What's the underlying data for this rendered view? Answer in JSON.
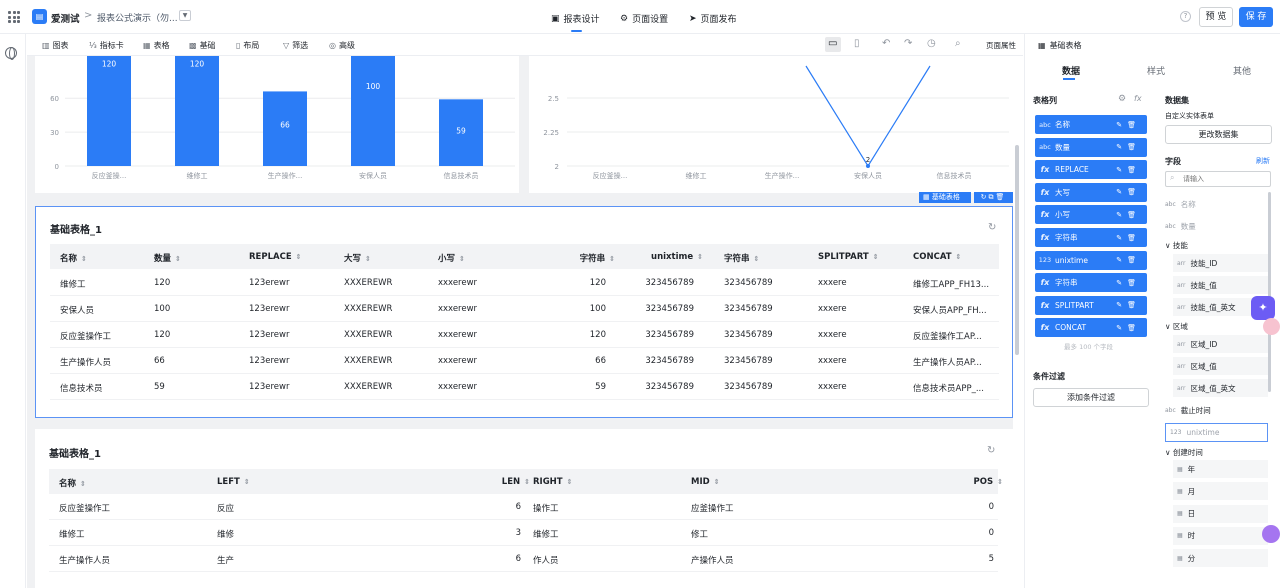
{
  "topbar": {
    "app_name": "爱测试",
    "breadcrumb_sep": ">",
    "report_name": "报表公式演示（勿...",
    "tabs": [
      {
        "label": "报表设计",
        "icon": "report-design-icon"
      },
      {
        "label": "页面设置",
        "icon": "gear-icon"
      },
      {
        "label": "页面发布",
        "icon": "send-icon"
      }
    ],
    "help": "?",
    "preview_label": "预 览",
    "save_label": "保 存"
  },
  "toolbar": {
    "items": [
      {
        "label": "图表",
        "icon": "chart-icon"
      },
      {
        "label": "指标卡",
        "icon": "metric-card-icon"
      },
      {
        "label": "表格",
        "icon": "table-icon"
      },
      {
        "label": "基础",
        "icon": "basic-icon"
      },
      {
        "label": "布局",
        "icon": "layout-icon"
      },
      {
        "label": "筛选",
        "icon": "filter-icon"
      },
      {
        "label": "高级",
        "icon": "advanced-icon"
      }
    ],
    "page_props": "页面属性"
  },
  "bar_chart": {
    "chart_data": {
      "type": "bar",
      "categories": [
        "反应釜操...",
        "维修工",
        "生产操作...",
        "安保人员",
        "信息技术员"
      ],
      "values": [
        120,
        120,
        66,
        100,
        59
      ],
      "y_ticks": [
        "0",
        "30",
        "60"
      ],
      "ylim": [
        0,
        150
      ]
    }
  },
  "line_chart": {
    "chart_data": {
      "type": "line",
      "categories": [
        "反应釜操...",
        "维修工",
        "生产操作...",
        "安保人员",
        "信息技术员"
      ],
      "y_ticks": [
        "2",
        "2.25",
        "2.5"
      ],
      "point_label": "2"
    }
  },
  "table1": {
    "title": "基础表格_1",
    "selected_tag": "基础表格",
    "headers": [
      "名称",
      "数量",
      "REPLACE",
      "大写",
      "小写",
      "字符串",
      "unixtime",
      "字符串",
      "SPLITPART",
      "CONCAT"
    ],
    "rows": [
      [
        "维修工",
        "120",
        "123erewr",
        "XXXEREWR",
        "xxxerewr",
        "120",
        "323456789",
        "323456789",
        "xxxere",
        "维修工APP_FH13..."
      ],
      [
        "安保人员",
        "100",
        "123erewr",
        "XXXEREWR",
        "xxxerewr",
        "100",
        "323456789",
        "323456789",
        "xxxere",
        "安保人员APP_FH..."
      ],
      [
        "反应釜操作工",
        "120",
        "123erewr",
        "XXXEREWR",
        "xxxerewr",
        "120",
        "323456789",
        "323456789",
        "xxxere",
        "反应釜操作工AP..."
      ],
      [
        "生产操作人员",
        "66",
        "123erewr",
        "XXXEREWR",
        "xxxerewr",
        "66",
        "323456789",
        "323456789",
        "xxxere",
        "生产操作人员AP..."
      ],
      [
        "信息技术员",
        "59",
        "123erewr",
        "XXXEREWR",
        "xxxerewr",
        "59",
        "323456789",
        "323456789",
        "xxxere",
        "信息技术员APP_..."
      ]
    ]
  },
  "table2": {
    "title": "基础表格_1",
    "headers": [
      "名称",
      "LEFT",
      "LEN",
      "RIGHT",
      "MID",
      "POS"
    ],
    "rows": [
      [
        "反应釜操作工",
        "反应",
        "6",
        "操作工",
        "应釜操作工",
        "0"
      ],
      [
        "维修工",
        "维修",
        "3",
        "维修工",
        "修工",
        "0"
      ],
      [
        "生产操作人员",
        "生产",
        "6",
        "作人员",
        "产操作人员",
        "5"
      ]
    ]
  },
  "panel_left": {
    "title": "基础表格",
    "tabs": [
      "数据",
      "样式",
      "其他"
    ],
    "columns_label": "表格列",
    "columns": [
      {
        "kind": "abc",
        "name": "名称"
      },
      {
        "kind": "abc",
        "name": "数量"
      },
      {
        "kind": "fx",
        "name": "REPLACE"
      },
      {
        "kind": "fx",
        "name": "大写"
      },
      {
        "kind": "fx",
        "name": "小写"
      },
      {
        "kind": "fx",
        "name": "字符串"
      },
      {
        "kind": "123",
        "name": "unixtime"
      },
      {
        "kind": "fx",
        "name": "字符串"
      },
      {
        "kind": "fx",
        "name": "SPLITPART"
      },
      {
        "kind": "fx",
        "name": "CONCAT"
      }
    ],
    "max_hint": "最多 100 个字段",
    "filter_label": "条件过滤",
    "add_filter": "添加条件过滤"
  },
  "panel_right": {
    "dataset_label": "数据集",
    "dataset_name": "自定义实体表单",
    "change_dataset": "更改数据集",
    "fields_label": "字段",
    "refresh": "刷新",
    "search_placeholder": "请输入",
    "fields": [
      {
        "kind": "abc",
        "name": "名称",
        "muted": true,
        "sub": false
      },
      {
        "kind": "abc",
        "name": "数量",
        "muted": true,
        "sub": false
      }
    ],
    "group_skill": "技能",
    "skill_fields": [
      {
        "kind": "arr",
        "name": "技能_ID"
      },
      {
        "kind": "arr",
        "name": "技能_值"
      },
      {
        "kind": "arr",
        "name": "技能_值_英文"
      }
    ],
    "group_area": "区域",
    "area_fields": [
      {
        "kind": "arr",
        "name": "区域_ID"
      },
      {
        "kind": "arr",
        "name": "区域_值"
      },
      {
        "kind": "arr",
        "name": "区域_值_英文"
      }
    ],
    "deadline": {
      "kind": "abc",
      "name": "截止时间"
    },
    "unixtime": {
      "kind": "123",
      "name": "unixtime"
    },
    "group_created": "创建时间",
    "created_fields": [
      "年",
      "月",
      "日",
      "时",
      "分"
    ]
  }
}
